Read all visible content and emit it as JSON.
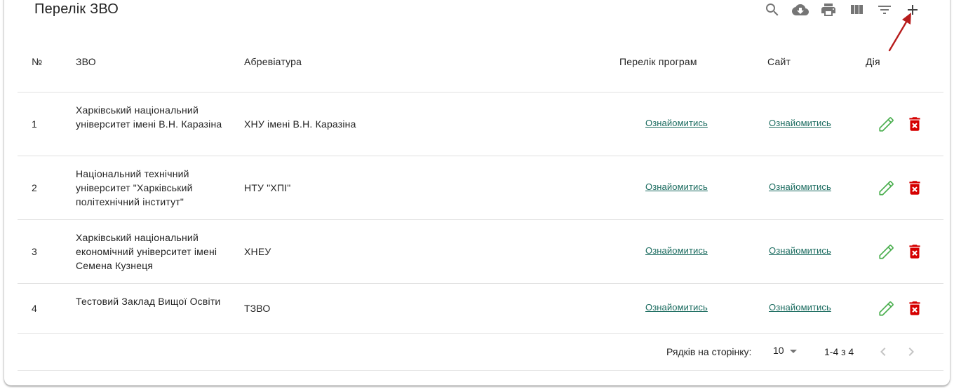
{
  "toolbar": {
    "title": "Перелік ЗВО",
    "icons": [
      "search-icon",
      "download-icon",
      "print-icon",
      "view-columns-icon",
      "filter-icon",
      "add-icon"
    ]
  },
  "table": {
    "headers": {
      "num": "№",
      "name": "ЗВО",
      "abbr": "Абревіатура",
      "programs": "Перелік програм",
      "site": "Сайт",
      "action": "Дія"
    },
    "rows": [
      {
        "num": "1",
        "name": "Харківський національний університет імені В.Н. Каразіна",
        "abbr": "ХНУ імені В.Н. Каразіна",
        "programs": "Ознайомитись",
        "site": "Ознайомитись"
      },
      {
        "num": "2",
        "name": "Національний технічний університет \"Харківський політехнічний інститут\"",
        "abbr": "НТУ \"ХПІ\"",
        "programs": "Ознайомитись",
        "site": "Ознайомитись"
      },
      {
        "num": "3",
        "name": "Харківський національний економічний університет імені Семена Кузнеця",
        "abbr": "ХНЕУ",
        "programs": "Ознайомитись",
        "site": "Ознайомитись"
      },
      {
        "num": "4",
        "name": "Тестовий Заклад Вищої Освіти",
        "abbr": "ТЗВО",
        "programs": "Ознайомитись",
        "site": "Ознайомитись"
      }
    ]
  },
  "pagination": {
    "rows_label": "Рядків на сторінку:",
    "rows_value": "10",
    "range": "1-4 з 4"
  },
  "colors": {
    "link": "#1a6b5f",
    "edit": "#4caf50",
    "delete": "#d50000",
    "arrow": "#b71c1c"
  }
}
